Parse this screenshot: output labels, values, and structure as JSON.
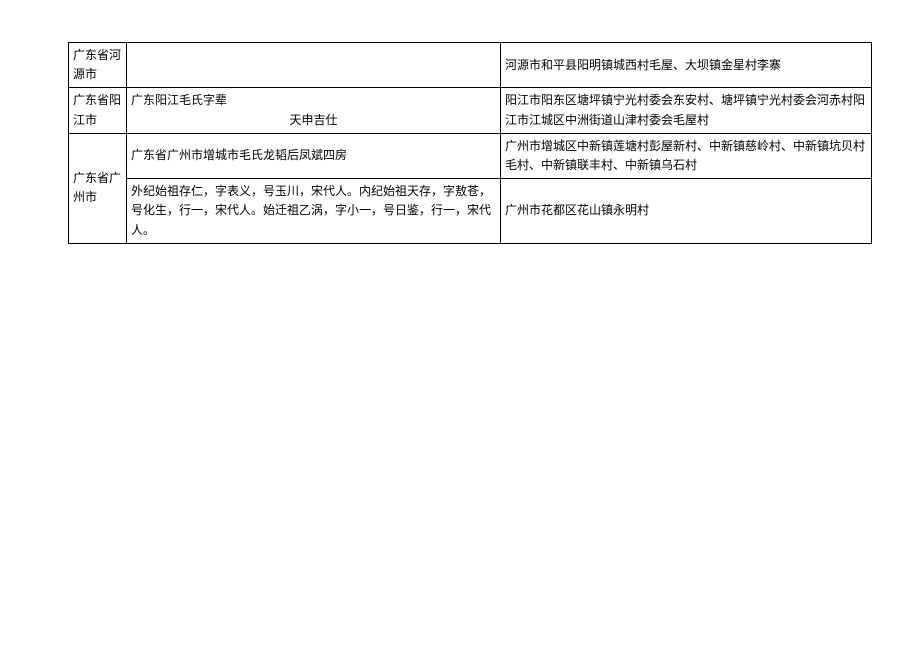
{
  "rows": [
    {
      "region": "广东省河源市",
      "middle": "",
      "right": "河源市和平县阳明镇城西村毛屋、大坝镇金星村李寨"
    },
    {
      "region": "广东省阳江市",
      "middle_line1": "广东阳江毛氏字辈",
      "middle_line2": "天申吉仕",
      "right": "阳江市阳东区塘坪镇宁光村委会东安村、塘坪镇宁光村委会河赤村阳江市江城区中洲街道山津村委会毛屋村"
    },
    {
      "region": "广东省广州市",
      "middle_a": "广东省广州市增城市毛氏龙韬后凤斌四房",
      "middle_b": "外纪始祖存仁，字表义，号玉川，宋代人。内纪始祖天存，字敖苍，号化生，行一，宋代人。始迁祖乙涡，字小一，号日鉴，行一，宋代人。",
      "right_a": "广州市增城区中新镇莲塘村彭屋新村、中新镇慈岭村、中新镇坑贝村毛村、中新镇联丰村、中新镇乌石村",
      "right_b": "广州市花都区花山镇永明村"
    }
  ]
}
